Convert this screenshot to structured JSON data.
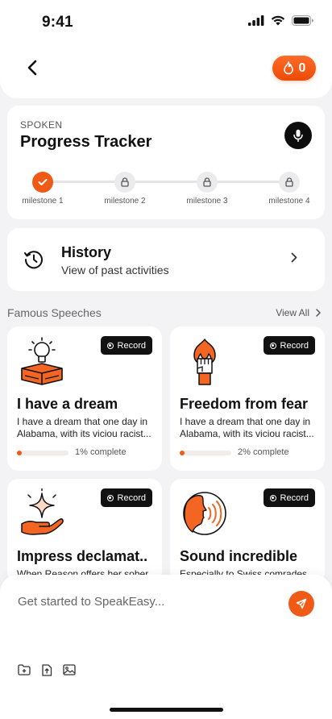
{
  "status_bar": {
    "time": "9:41"
  },
  "header": {
    "streak_count": "0",
    "icons": [
      "back-chevron-icon",
      "flame-icon"
    ]
  },
  "progress_tracker": {
    "kicker": "SPOKEN",
    "title": "Progress Tracker",
    "milestones": [
      {
        "label": "milestone 1",
        "state": "done"
      },
      {
        "label": "milestone 2",
        "state": "locked"
      },
      {
        "label": "milestone 3",
        "state": "locked"
      },
      {
        "label": "milestone 4",
        "state": "locked"
      }
    ]
  },
  "history": {
    "title": "History",
    "subtitle": "View of past activities"
  },
  "famous_speeches": {
    "title": "Famous Speeches",
    "view_all": "View All",
    "record_label": "Record",
    "cards": [
      {
        "title": "I have a dream",
        "desc": "I have a dream that one day in Alabama, with its viciou racist...",
        "progress_text": "1% complete",
        "progress": 0.01,
        "illustration": "lightbulb-box-icon"
      },
      {
        "title": "Freedom from fear",
        "desc": "I have a dream that one day in Alabama, with its viciou racist...",
        "progress_text": "2% complete",
        "progress": 0.02,
        "illustration": "raised-fist-icon"
      },
      {
        "title": "Impress declamat..",
        "desc": "When Reason offers her sober",
        "progress_text": "",
        "progress": null,
        "illustration": "sparkle-hand-icon"
      },
      {
        "title": "Sound incredible",
        "desc": "Especially to Swiss comrades",
        "progress_text": "",
        "progress": null,
        "illustration": "speaking-head-icon"
      }
    ]
  },
  "composer": {
    "placeholder": "Get started to SpeakEasy..."
  },
  "colors": {
    "accent": "#f05a17",
    "dark": "#111111",
    "background": "#f3f2f4"
  }
}
